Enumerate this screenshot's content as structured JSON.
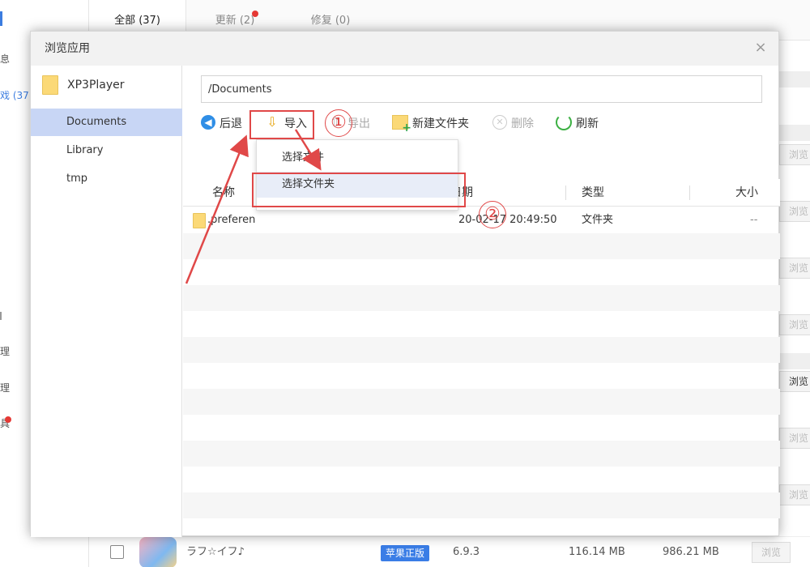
{
  "background": {
    "sidebar": {
      "items": [
        {
          "label": "息"
        },
        {
          "label": "戏 (37"
        },
        {
          "label": "理"
        },
        {
          "label": "理"
        },
        {
          "label": "具"
        }
      ]
    },
    "tabs": [
      {
        "label": "全部 (37)"
      },
      {
        "label": "更新 (2)"
      },
      {
        "label": "修复 (0)"
      }
    ],
    "browse_label": "浏览",
    "bottom_row": {
      "name": "ラフ☆イフ♪",
      "badge": "苹果正版",
      "version": "6.9.3",
      "size1": "116.14 MB",
      "size2": "986.21 MB",
      "browse": "浏览"
    }
  },
  "dialog": {
    "title": "浏览应用",
    "close_glyph": "×",
    "tree": {
      "root": "XP3Player",
      "items": [
        {
          "label": "Documents",
          "selected": true
        },
        {
          "label": "Library",
          "selected": false
        },
        {
          "label": "tmp",
          "selected": false
        }
      ]
    },
    "path": "/Documents",
    "toolbar": {
      "back": "后退",
      "import": "导入",
      "export": "导出",
      "new_folder": "新建文件夹",
      "delete": "删除",
      "refresh": "刷新"
    },
    "table": {
      "headers": {
        "name": "名称",
        "date": "日期",
        "type": "类型",
        "size": "大小"
      },
      "rows": [
        {
          "name": ".preferen",
          "date": "20-02-17 20:49:50",
          "type": "文件夹",
          "size": "--"
        }
      ]
    },
    "import_menu": {
      "items": [
        {
          "label": "选择文件"
        },
        {
          "label": "选择文件夹"
        }
      ]
    }
  },
  "annotations": {
    "step1": "①",
    "step2": "②",
    "color": "#e04848"
  }
}
